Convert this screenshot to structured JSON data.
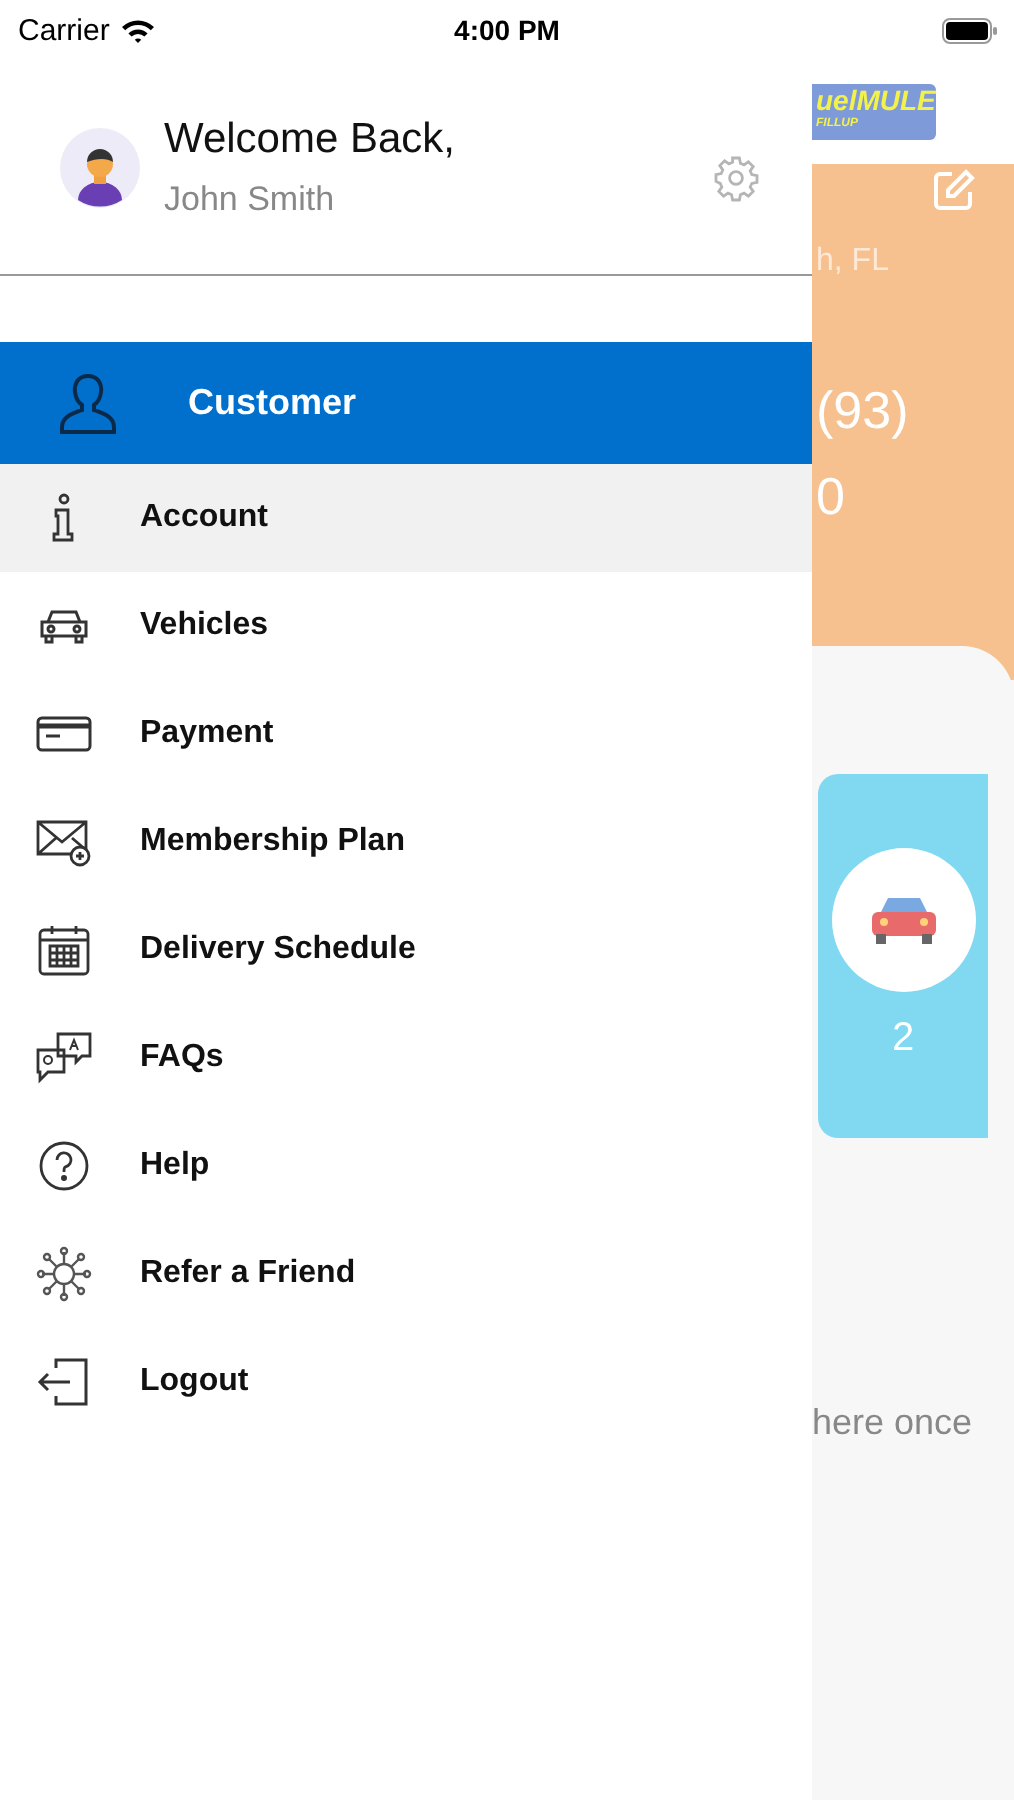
{
  "status_bar": {
    "carrier": "Carrier",
    "time": "4:00 PM"
  },
  "drawer": {
    "greeting": "Welcome Back,",
    "user_name": "John Smith",
    "section": {
      "label": "Customer"
    },
    "menu": [
      {
        "label": "Account",
        "kind": "info",
        "selected": true
      },
      {
        "label": "Vehicles",
        "kind": "car",
        "selected": false
      },
      {
        "label": "Payment",
        "kind": "card",
        "selected": false
      },
      {
        "label": "Membership Plan",
        "kind": "mail",
        "selected": false
      },
      {
        "label": "Delivery Schedule",
        "kind": "calendar",
        "selected": false
      },
      {
        "label": "FAQs",
        "kind": "faq",
        "selected": false
      },
      {
        "label": "Help",
        "kind": "help",
        "selected": false
      },
      {
        "label": "Refer a Friend",
        "kind": "refer",
        "selected": false
      },
      {
        "label": "Logout",
        "kind": "logout",
        "selected": false
      }
    ]
  },
  "background_screen": {
    "logo": {
      "main": "uelMULE",
      "sub": "FILLUP"
    },
    "location": "h, FL",
    "line_1": "(93)",
    "line_2": "0",
    "vehicle_count": "2",
    "message": "here once"
  }
}
